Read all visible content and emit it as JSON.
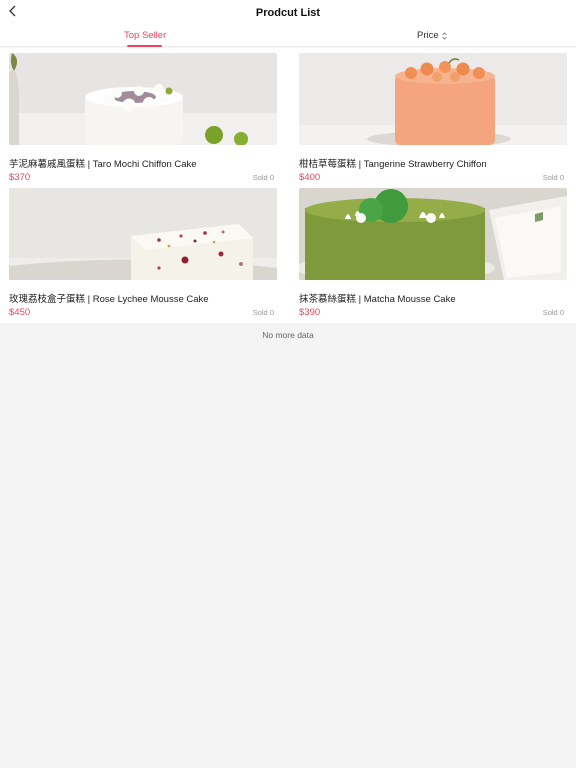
{
  "header": {
    "title": "Prodcut List",
    "back_icon": "chevron-left-icon"
  },
  "tabs": [
    {
      "label": "Top Seller",
      "active": true
    },
    {
      "label": "Price",
      "icon": "sort-updown-icon",
      "active": false
    }
  ],
  "products": [
    {
      "name": "芋泥麻薯戚風蛋糕 | Taro Mochi Chiffon Cake",
      "price": "$370",
      "sold": "Sold 0"
    },
    {
      "name": "柑桔草莓蛋糕 | Tangerine Strawberry Chiffon",
      "price": "$400",
      "sold": "Sold 0"
    },
    {
      "name": "玫瑰荔枝盒子蛋糕 | Rose Lychee Mousse Cake",
      "price": "$450",
      "sold": "Sold 0"
    },
    {
      "name": "抹茶慕絲蛋糕 | Matcha Mousse Cake",
      "price": "$390",
      "sold": "Sold 0"
    }
  ],
  "footer": {
    "no_more": "No more data"
  },
  "colors": {
    "accent": "#e8455e",
    "background": "#f4f4f4"
  }
}
